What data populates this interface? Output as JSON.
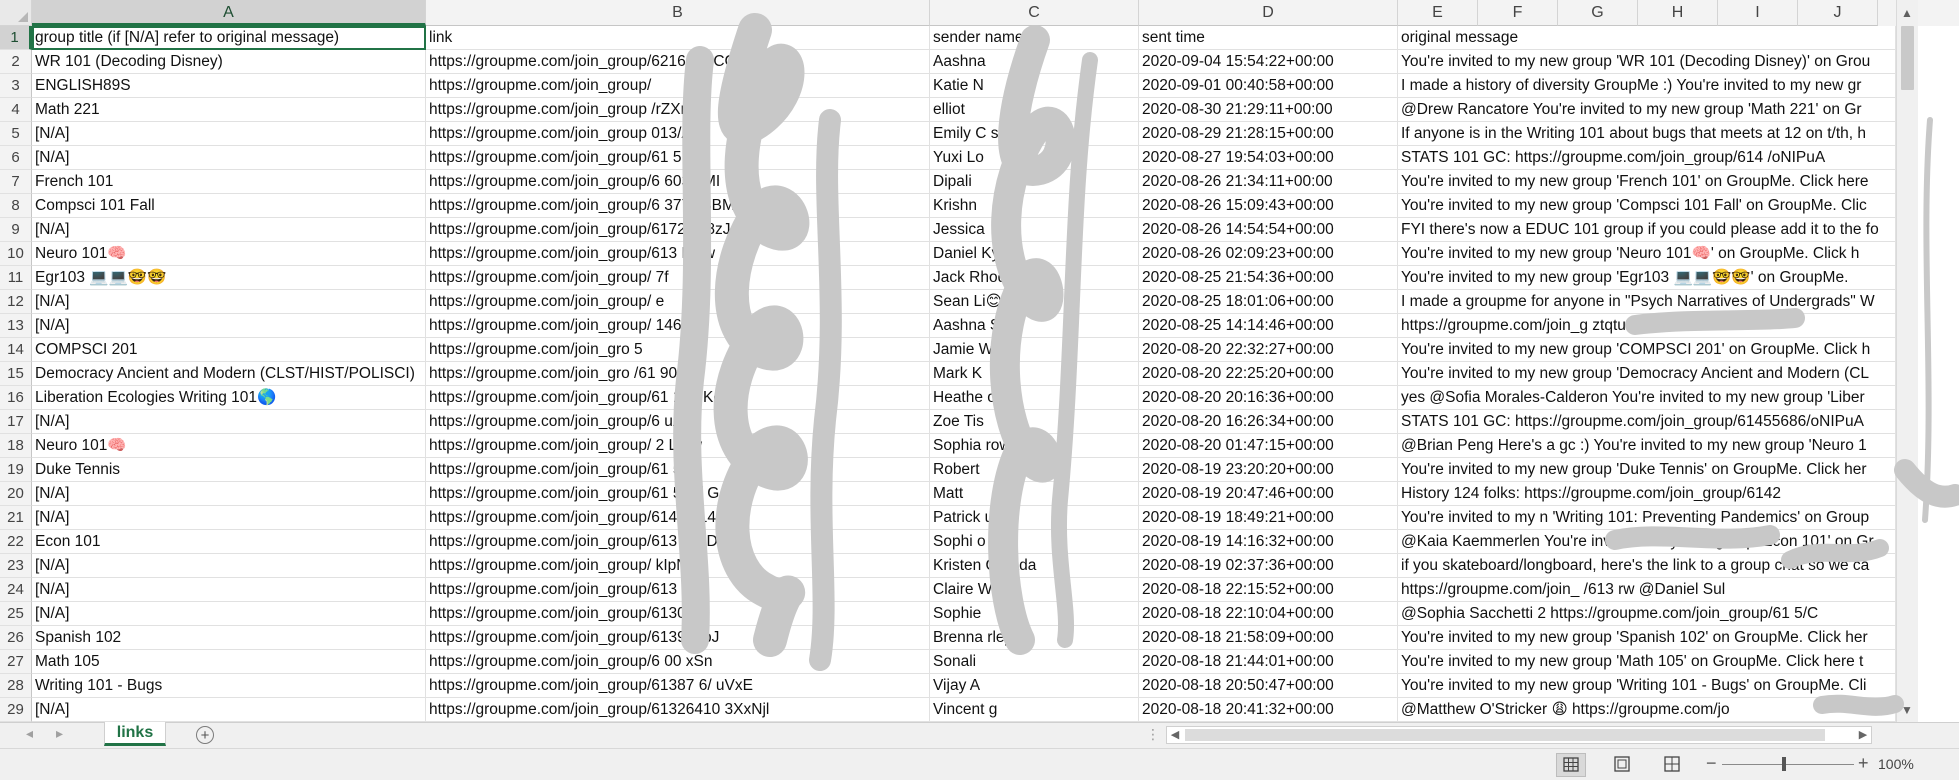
{
  "workbook": {
    "active_cell": "A1",
    "column_letters": [
      "A",
      "B",
      "C",
      "D",
      "E",
      "F",
      "G",
      "H",
      "I",
      "J"
    ],
    "rows": [
      {
        "n": "1",
        "a": "group title (if [N/A] refer to original message)",
        "b": "link",
        "c": "sender name",
        "d": "sent time",
        "e": "original message"
      },
      {
        "n": "2",
        "a": "WR 101 (Decoding Disney)",
        "b": "https://groupme.com/join_group/62164 /YCGW3Uxt",
        "c": "Aashna",
        "d": "2020-09-04 15:54:22+00:00",
        "e": "You're invited to my new group 'WR 101 (Decoding Disney)' on Grou"
      },
      {
        "n": "3",
        "a": "ENGLISH89S",
        "b": "https://groupme.com/join_group/",
        "c": "Katie N",
        "d": "2020-09-01 00:40:58+00:00",
        "e": "I made a history of diversity GroupMe :) You're invited to my new gr"
      },
      {
        "n": "4",
        "a": "Math 221",
        "b": "https://groupme.com/join_group /rZXm X",
        "c": "elliot",
        "d": "2020-08-30 21:29:11+00:00",
        "e": "@Drew Rancatore You're invited to my new group 'Math 221' on Gr"
      },
      {
        "n": "5",
        "a": "[N/A]",
        "b": "https://groupme.com/join_group 013/A",
        "c": "Emily C son",
        "d": "2020-08-29 21:28:15+00:00",
        "e": "If anyone is in the Writing 101 about bugs that meets at 12 on t/th, h"
      },
      {
        "n": "6",
        "a": "[N/A]",
        "b": "https://groupme.com/join_group/61 5 AwI",
        "c": "Yuxi Lo",
        "d": "2020-08-27 19:54:03+00:00",
        "e": "STATS 101 GC: https://groupme.com/join_group/614 /oNIPuA"
      },
      {
        "n": "7",
        "a": "French 101",
        "b": "https://groupme.com/join_group/6 603 eMI",
        "c": "Dipali",
        "d": "2020-08-26 21:34:11+00:00",
        "e": "You're invited to my new group 'French 101' on GroupMe. Click here"
      },
      {
        "n": "8",
        "a": "Compsci 101 Fall",
        "b": "https://groupme.com/join_group/6 377 q3BM",
        "c": "Krishn",
        "d": "2020-08-26 15:09:43+00:00",
        "e": "You're invited to my new group 'Compsci 101 Fall' on GroupMe. Clic"
      },
      {
        "n": "9",
        "a": "[N/A]",
        "b": "https://groupme.com/join_group/6172 Cr8zJ",
        "c": "Jessica",
        "d": "2020-08-26 14:54:54+00:00",
        "e": "FYI there's now a EDUC 101 group if you could please add it to the fo"
      },
      {
        "n": "10",
        "a": "Neuro 101🧠",
        "b": "https://groupme.com/join_group/613 Ldrw",
        "c": "Daniel Ky g l",
        "d": "2020-08-26 02:09:23+00:00",
        "e": "You're invited to my new group 'Neuro 101🧠' on GroupMe. Click h"
      },
      {
        "n": "11",
        "a": "Egr103 💻💻🤓🤓",
        "b": "https://groupme.com/join_group/ 7f",
        "c": "Jack Rhod",
        "d": "2020-08-25 21:54:36+00:00",
        "e": "You're invited to my new group 'Egr103 💻💻🤓🤓' on GroupMe."
      },
      {
        "n": "12",
        "a": "[N/A]",
        "b": "https://groupme.com/join_group/ e",
        "c": "Sean Li😊",
        "d": "2020-08-25 18:01:06+00:00",
        "e": "I made a groupme for anyone in \"Psych Narratives of Undergrads\" W"
      },
      {
        "n": "13",
        "a": "[N/A]",
        "b": "https://groupme.com/join_group/ 146 qt",
        "c": "Aashna S",
        "d": "2020-08-25 14:14:46+00:00",
        "e": "https://groupme.com/join_g ztqtuKxW"
      },
      {
        "n": "14",
        "a": "COMPSCI 201",
        "b": "https://groupme.com/join_gro 5",
        "c": "Jamie Wan",
        "d": "2020-08-20 22:32:27+00:00",
        "e": "You're invited to my new group 'COMPSCI 201' on GroupMe. Click h"
      },
      {
        "n": "15",
        "a": "Democracy Ancient and Modern (CLST/HIST/POLISCI)",
        "b": "https://groupme.com/join_gro /61 90 kO",
        "c": "Mark K",
        "d": "2020-08-20 22:25:20+00:00",
        "e": "You're invited to my new group 'Democracy Ancient and Modern (CL"
      },
      {
        "n": "16",
        "a": "Liberation Ecologies Writing 101🌎",
        "b": "https://groupme.com/join_group/61 175 Kcgg",
        "c": "Heathe ok",
        "d": "2020-08-20 20:16:36+00:00",
        "e": "yes @Sofia Morales-Calderon You're invited to my new group 'Liber"
      },
      {
        "n": "17",
        "a": "[N/A]",
        "b": "https://groupme.com/join_group/6 uAwI",
        "c": "Zoe Tis",
        "d": "2020-08-20 16:26:34+00:00",
        "e": "STATS 101 GC: https://groupme.com/join_group/61455686/oNIPuA"
      },
      {
        "n": "18",
        "a": "Neuro 101🧠",
        "b": "https://groupme.com/join_group/ 2 Ldrw",
        "c": "Sophia row",
        "d": "2020-08-20 01:47:15+00:00",
        "e": "@Brian Peng Here's a gc :)  You're invited to my new group 'Neuro 1"
      },
      {
        "n": "19",
        "a": "Duke Tennis",
        "b": "https://groupme.com/join_group/61 52/",
        "c": "Robert",
        "d": "2020-08-19 23:20:20+00:00",
        "e": "You're invited to my new group 'Duke Tennis' on GroupMe. Click her"
      },
      {
        "n": "20",
        "a": "[N/A]",
        "b": "https://groupme.com/join_group/61 527/ G",
        "c": "Matt",
        "d": "2020-08-19 20:47:46+00:00",
        "e": "History 124 folks:  https://groupme.com/join_group/6142"
      },
      {
        "n": "21",
        "a": "[N/A]",
        "b": "https://groupme.com/join_group/6142 914/ Vd",
        "c": "Patrick uin",
        "d": "2020-08-19 18:49:21+00:00",
        "e": "You're invited to my n 'Writing 101: Preventing Pandemics' on Group"
      },
      {
        "n": "22",
        "a": "Econ 101",
        "b": "https://groupme.com/join_group/613 dc1D",
        "c": "Sophi o",
        "d": "2020-08-19 14:16:32+00:00",
        "e": "@Kaia Kaemmerlen You're invited to my new group 'Econ 101' on Gr"
      },
      {
        "n": "23",
        "a": "[N/A]",
        "b": "https://groupme.com/join_group/ kIpN",
        "c": "Kristen Qu ada",
        "d": "2020-08-19 02:37:36+00:00",
        "e": "if you skateboard/longboard, here's the link to a group chat so we ca"
      },
      {
        "n": "24",
        "a": "[N/A]",
        "b": "https://groupme.com/join_group/613 w",
        "c": "Claire Wa g",
        "d": "2020-08-18 22:15:52+00:00",
        "e": "https://groupme.com/join_ /613 rw @Daniel Sul"
      },
      {
        "n": "25",
        "a": "[N/A]",
        "b": "https://groupme.com/join_group/6130 1D",
        "c": "Sophie",
        "d": "2020-08-18 22:10:04+00:00",
        "e": "@Sophia Sacchetti 2  https://groupme.com/join_group/61 5/C"
      },
      {
        "n": "26",
        "a": "Spanish 102",
        "b": "https://groupme.com/join_group/6139 1 pJ",
        "c": "Brenna rley",
        "d": "2020-08-18 21:58:09+00:00",
        "e": "You're invited to my new group 'Spanish 102' on GroupMe. Click her"
      },
      {
        "n": "27",
        "a": "Math 105",
        "b": "https://groupme.com/join_group/6 00 xSn",
        "c": "Sonali",
        "d": "2020-08-18 21:44:01+00:00",
        "e": "You're invited to my new group 'Math 105' on GroupMe. Click here t"
      },
      {
        "n": "28",
        "a": "Writing 101 - Bugs",
        "b": "https://groupme.com/join_group/61387 6/ uVxE",
        "c": "Vijay A",
        "d": "2020-08-18 20:50:47+00:00",
        "e": "You're invited to my new group 'Writing 101 - Bugs' on GroupMe. Cli"
      },
      {
        "n": "29",
        "a": "[N/A]",
        "b": "https://groupme.com/join_group/61326410 3XxNjl",
        "c": "Vincent g",
        "d": "2020-08-18 20:41:32+00:00",
        "e": "@Matthew O'Stricker 😩  https://groupme.com/jo"
      }
    ]
  },
  "sheet_tab": {
    "label": "links",
    "add_symbol": "+"
  },
  "status_bar": {
    "zoom": "100%",
    "zoom_minus": "−",
    "zoom_plus": "+"
  },
  "colors": {
    "accent": "#217346",
    "grid": "#e1e1e1",
    "header_bg": "#f3f3f3"
  }
}
